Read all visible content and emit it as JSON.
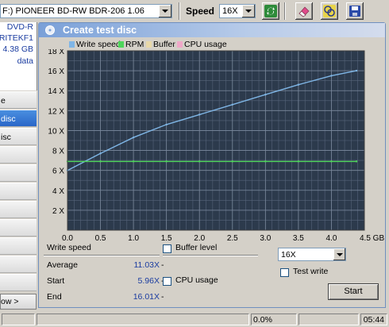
{
  "toolbar": {
    "drive": "F:) PIONEER BD-RW   BDR-206 1.06",
    "speed_label": "Speed",
    "speed_value": "16X"
  },
  "left": {
    "disc_type": "DVD-R",
    "manufacturer": "RITEKF1",
    "capacity": "4.38 GB",
    "content": "data",
    "nav": [
      "e",
      "disc",
      "isc"
    ],
    "bottom_button": "ow >"
  },
  "dialog": {
    "title": "Create test disc",
    "legend": [
      {
        "label": "Write speed",
        "color": "#7fb6e6"
      },
      {
        "label": "RPM",
        "color": "#4ed65a"
      },
      {
        "label": "Buffer",
        "color": "#e8d8a8"
      },
      {
        "label": "CPU usage",
        "color": "#f0a8c8"
      }
    ],
    "stats": {
      "header": "Write speed",
      "rows": [
        {
          "label": "Average",
          "value": "11.03X"
        },
        {
          "label": "Start",
          "value": "5.96X"
        },
        {
          "label": "End",
          "value": "16.01X"
        }
      ],
      "dash": "-"
    },
    "buffer_label": "Buffer level",
    "cpu_label": "CPU usage",
    "speed_select": "16X",
    "test_write_label": "Test write",
    "start_label": "Start"
  },
  "chart_data": {
    "type": "line",
    "title": "",
    "xlabel": "",
    "ylabel": "",
    "x_unit": "GB",
    "xlim": [
      0,
      4.5
    ],
    "ylim": [
      0,
      18
    ],
    "x_ticks": [
      "0.0",
      "0.5",
      "1.0",
      "1.5",
      "2.0",
      "2.5",
      "3.0",
      "3.5",
      "4.0",
      "4.5 GB"
    ],
    "y_ticks": [
      "2 X",
      "4 X",
      "6 X",
      "8 X",
      "10 X",
      "12 X",
      "14 X",
      "16 X",
      "18 X"
    ],
    "grid": true,
    "series": [
      {
        "name": "Write speed",
        "color": "#7fb6e6",
        "x": [
          0,
          0.5,
          1.0,
          1.5,
          2.0,
          2.5,
          3.0,
          3.5,
          4.0,
          4.38
        ],
        "y": [
          6.0,
          7.7,
          9.3,
          10.6,
          11.6,
          12.6,
          13.6,
          14.6,
          15.5,
          16.0
        ]
      },
      {
        "name": "RPM",
        "color": "#4ed65a",
        "x": [
          0,
          0.5,
          1.0,
          1.5,
          2.0,
          2.5,
          3.0,
          3.5,
          4.0,
          4.38
        ],
        "y": [
          6.9,
          6.9,
          6.9,
          6.9,
          6.9,
          6.9,
          6.9,
          6.9,
          6.9,
          6.9
        ]
      }
    ]
  },
  "statusbar": {
    "progress": "0.0%",
    "time": "05:44"
  }
}
